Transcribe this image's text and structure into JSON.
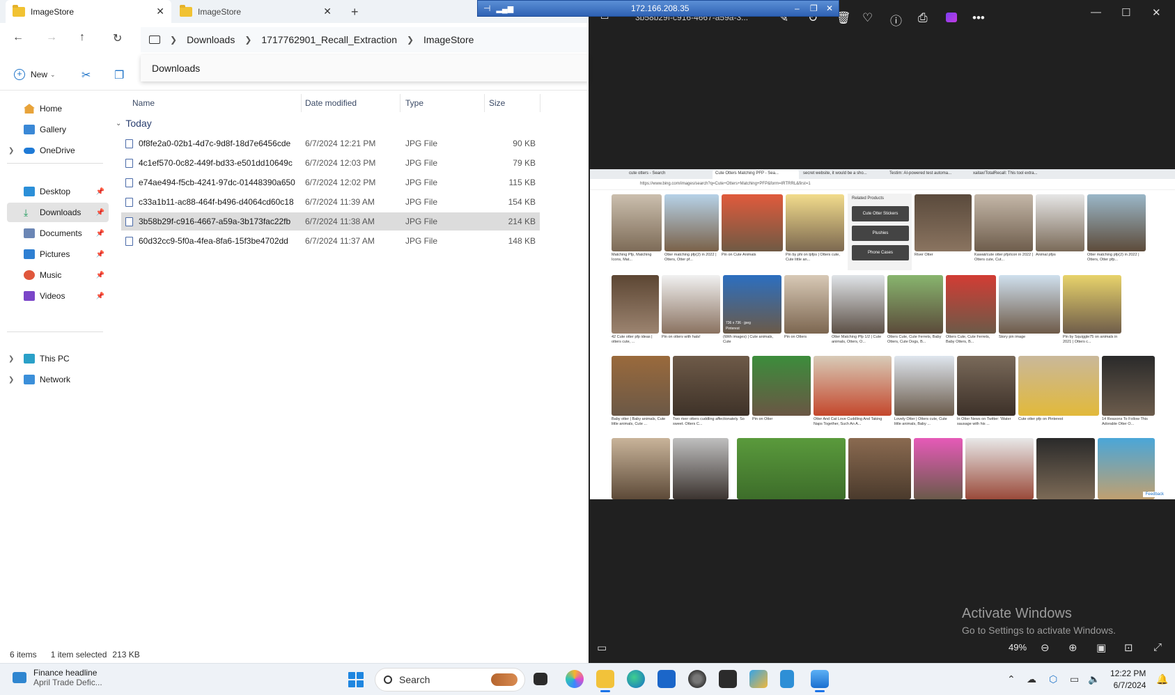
{
  "explorer": {
    "tabs": [
      {
        "label": "ImageStore"
      },
      {
        "label": "ImageStore"
      }
    ],
    "breadcrumb": [
      "Downloads",
      "1717762901_Recall_Extraction",
      "ImageStore"
    ],
    "dropdown_suggestion": "Downloads",
    "new_label": "New",
    "nav": {
      "home": "Home",
      "gallery": "Gallery",
      "onedrive": "OneDrive",
      "desktop": "Desktop",
      "downloads": "Downloads",
      "documents": "Documents",
      "pictures": "Pictures",
      "music": "Music",
      "videos": "Videos",
      "thispc": "This PC",
      "network": "Network"
    },
    "columns": {
      "name": "Name",
      "date": "Date modified",
      "type": "Type",
      "size": "Size"
    },
    "group": "Today",
    "files": [
      {
        "name": "0f8fe2a0-02b1-4d7c-9d8f-18d7e6456cde",
        "date": "6/7/2024 12:21 PM",
        "type": "JPG File",
        "size": "90 KB"
      },
      {
        "name": "4c1ef570-0c82-449f-bd33-e501dd10649c",
        "date": "6/7/2024 12:03 PM",
        "type": "JPG File",
        "size": "79 KB"
      },
      {
        "name": "e74ae494-f5cb-4241-97dc-01448390a650",
        "date": "6/7/2024 12:02 PM",
        "type": "JPG File",
        "size": "115 KB"
      },
      {
        "name": "c33a1b11-ac88-464f-b496-d4064cd60c18",
        "date": "6/7/2024 11:39 AM",
        "type": "JPG File",
        "size": "154 KB"
      },
      {
        "name": "3b58b29f-c916-4667-a59a-3b173fac22fb",
        "date": "6/7/2024 11:38 AM",
        "type": "JPG File",
        "size": "214 KB"
      },
      {
        "name": "60d32cc9-5f0a-4fea-8fa6-15f3be4702dd",
        "date": "6/7/2024 11:37 AM",
        "type": "JPG File",
        "size": "148 KB"
      }
    ],
    "status": {
      "count": "6 items",
      "selected": "1 item selected",
      "size": "213 KB"
    }
  },
  "viewer": {
    "rdp_ip": "172.166.208.35",
    "title": "3b58b29f-c916-4667-a59a-3...",
    "zoom": "49%",
    "activate_title": "Activate Windows",
    "activate_sub": "Go to Settings to activate Windows.",
    "screenshot": {
      "tabs": [
        "cute otters - Search",
        "Cute Otters Matching PFP - Sea...",
        "secret website, it would be a sho...",
        "Testim: AI-powered test automa...",
        "xaitax/TotalRecall: This tool extra..."
      ],
      "url": "https://www.bing.com/images/search?q=Cute+Otters+Matching+PFP&form=IRTRRL&first=1",
      "related_title": "Related Products",
      "related": [
        "Cute Otter Stickers",
        "Plushies",
        "Phone Cases"
      ],
      "feedback": "Feedback",
      "captions_row1": [
        "Matching Pfp, Matching Icons, Mat...",
        "Otter matching pfp(2) in 2022 | Otters, Otter pf...",
        "Pin on Cute Animals",
        "Pin by phi on lpfps | Otters cute, Cute little an...",
        "River Otter",
        "Kawaii/cute otter pfp/icon in 2022 | Otters cute, Cut...",
        "Animal pfps",
        "Otter matching pfp(2) in 2022 | Otters, Otter pfp..."
      ],
      "captions_row2": [
        "42 Cute otter pfp ideas | otters cute, ...",
        "Pin on otters with hats!",
        "(With images) | Cute animals, Cute",
        "Pin on Otters",
        "Otter Matching Pfp 1/2 | Cute animals, Otters, O...",
        "Otters Cute, Cute Ferrets, Baby Otters, Cute Dogs, B...",
        "Otters Cute, Cute Ferrets, Baby Otters, B...",
        "Story pin image",
        "Pin by Squiggle75 on animals in 2021 | Otters c..."
      ],
      "captions_row3": [
        "Baby otter | Baby animals, Cute little animals, Cute ...",
        "Two river otters cuddling affectionately. So sweet. Otters C...",
        "Pin on Otter",
        "Otter And Cat Love Cuddling And Taking Naps Together, Such An A...",
        "Lovely Otter | Otters cute, Cute little animals, Baby ...",
        "In Otter News on Twitter: 'Water sausage with his ...",
        "Cute otter pfp on Pinterest",
        "14 Reasons To Follow This Adorable Otter O..."
      ],
      "badge": "736 x 736 · jpeg",
      "badge_source": "Pinterest"
    }
  },
  "taskbar": {
    "widget_title": "Finance headline",
    "widget_sub": "April Trade Defic...",
    "search": "Search",
    "time": "12:22 PM",
    "date": "6/7/2024"
  },
  "colors": {
    "accent": "#1e73c8",
    "viewer_bg": "#202020",
    "selection": "#dcdcdc"
  }
}
